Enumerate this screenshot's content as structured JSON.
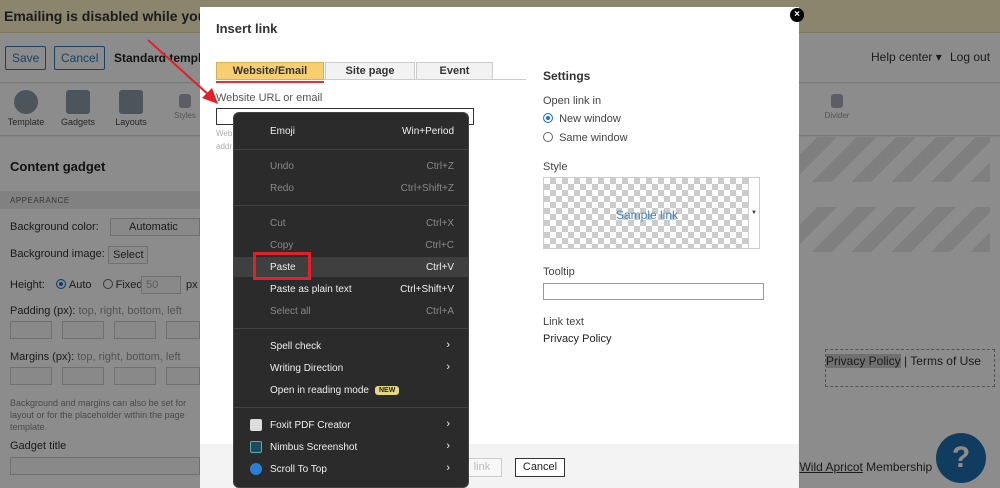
{
  "banner": {
    "text": "Emailing is disabled while you set"
  },
  "topbar": {
    "save_label": "Save",
    "cancel_label": "Cancel",
    "template_name": "Standard template",
    "help_label": "Help center ▾",
    "logout_label": "Log out"
  },
  "toolbar": {
    "template_label": "Template",
    "gadgets_label": "Gadgets",
    "layouts_label": "Layouts",
    "styles_label": "Styles",
    "divider_label": "Divider"
  },
  "left_panel": {
    "title": "Content gadget",
    "section": "APPEARANCE",
    "bg_color_label": "Background color:",
    "bg_color_value": "Automatic",
    "bg_image_label": "Background image:",
    "bg_image_button": "Select",
    "height_label": "Height:",
    "height_auto": "Auto",
    "height_fixed": "Fixed",
    "height_value": "50",
    "height_unit": "px",
    "padding_label": "Padding (px):",
    "padding_hint": "top, right, bottom, left",
    "margins_label": "Margins (px):",
    "margins_hint": "top, right, bottom, left",
    "note_line1": "Background and margins can also be set for",
    "note_line2": "layout or for the placeholder within the page",
    "note_line3": "template.",
    "gadget_title_label": "Gadget title"
  },
  "canvas": {
    "footer_link1": "Privacy Policy",
    "footer_sep": "|",
    "footer_link2": "Terms of Use",
    "powered_sep": "|",
    "powered_link": "Wild Apricot",
    "powered_text": "Membership",
    "help_fab": "?"
  },
  "dialog": {
    "title": "Insert link",
    "close": "×",
    "tabs": [
      "Website/Email",
      "Site page",
      "Event"
    ],
    "url_label": "Website URL or email",
    "url_value": "",
    "url_hint_line1": "Web",
    "url_hint_line2": "addr",
    "settings_title": "Settings",
    "open_link_label": "Open link in",
    "new_window": "New window",
    "same_window": "Same window",
    "style_label": "Style",
    "style_sample": "Sample link",
    "tooltip_label": "Tooltip",
    "tooltip_value": "",
    "link_text_label": "Link text",
    "link_text_value": "Privacy Policy",
    "ok_label": "link",
    "cancel_label": "Cancel"
  },
  "context_menu": {
    "items": [
      {
        "label": "Emoji",
        "shortcut": "Win+Period"
      },
      {
        "label": "Undo",
        "shortcut": "Ctrl+Z"
      },
      {
        "label": "Redo",
        "shortcut": "Ctrl+Shift+Z"
      },
      {
        "label": "Cut",
        "shortcut": "Ctrl+X"
      },
      {
        "label": "Copy",
        "shortcut": "Ctrl+C"
      },
      {
        "label": "Paste",
        "shortcut": "Ctrl+V"
      },
      {
        "label": "Paste as plain text",
        "shortcut": "Ctrl+Shift+V"
      },
      {
        "label": "Select all",
        "shortcut": "Ctrl+A"
      },
      {
        "label": "Spell check",
        "shortcut": ""
      },
      {
        "label": "Writing Direction",
        "shortcut": ""
      },
      {
        "label": "Open in reading mode",
        "shortcut": ""
      },
      {
        "label": "Foxit PDF Creator",
        "shortcut": ""
      },
      {
        "label": "Nimbus Screenshot",
        "shortcut": ""
      },
      {
        "label": "Scroll To Top",
        "shortcut": ""
      }
    ],
    "new_badge": "NEW",
    "submenu_arrow": "›"
  },
  "colors": {
    "highlight_box": "#e3202a",
    "active_tab": "#f7cf70",
    "menu_bg": "#2b2b2b",
    "primary": "#2b78b8"
  }
}
